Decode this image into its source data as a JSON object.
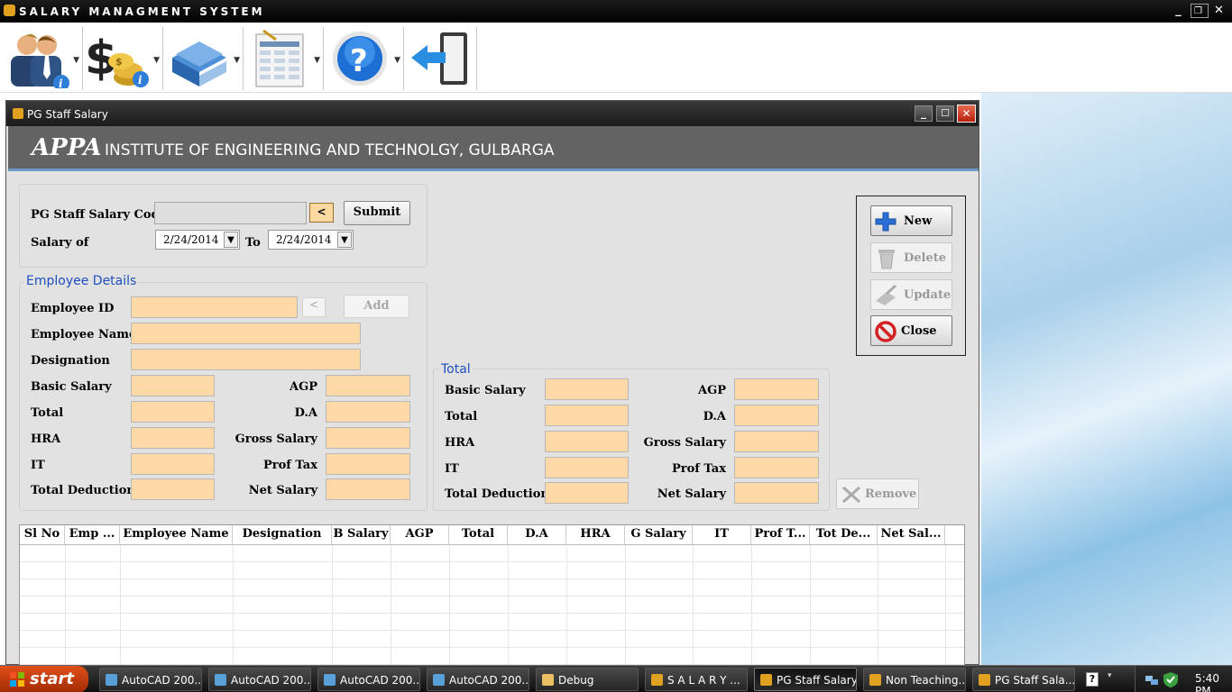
{
  "app": {
    "title": "SALARY MANAGMENT SYSTEM",
    "toolbar": [
      {
        "icon": "employee-info-icon"
      },
      {
        "icon": "salary-info-icon"
      },
      {
        "icon": "books-icon"
      },
      {
        "icon": "report-icon"
      },
      {
        "icon": "help-icon"
      },
      {
        "icon": "exit-icon"
      }
    ]
  },
  "window": {
    "title": "PG Staff Salary",
    "banner_logo": "APPA",
    "banner_name": "INSTITUTE OF ENGINEERING AND TECHNOLGY, GULBARGA"
  },
  "form": {
    "code_label": "PG Staff Salary Code",
    "code_value": "",
    "lookup_btn": "<",
    "submit_btn": "Submit",
    "salary_of_label": "Salary of",
    "date_from": "2/24/2014",
    "to_label": "To",
    "date_to": "2/24/2014"
  },
  "employee": {
    "legend": "Employee Details",
    "id_label": "Employee ID",
    "lookup_btn": "<",
    "add_btn": "Add",
    "name_label": "Employee Name",
    "designation_label": "Designation",
    "basic_salary": "Basic Salary",
    "agp": "AGP",
    "total": "Total",
    "da": "D.A",
    "hra": "HRA",
    "gross_salary": "Gross Salary",
    "it": "IT",
    "prof_tax": "Prof Tax",
    "total_deduction": "Total Deduction",
    "net_salary": "Net Salary"
  },
  "totals": {
    "legend": "Total",
    "basic_salary": "Basic Salary",
    "agp": "AGP",
    "total": "Total",
    "da": "D.A",
    "hra": "HRA",
    "gross_salary": "Gross Salary",
    "it": "IT",
    "prof_tax": "Prof Tax",
    "total_deduction": "Total Deduction",
    "net_salary": "Net Salary"
  },
  "actions": {
    "new": "New",
    "delete": "Delete",
    "update": "Update",
    "close": "Close",
    "remove": "Remove"
  },
  "grid": {
    "columns": [
      "Sl No",
      "Emp ...",
      "Employee Name",
      "Designation",
      "B Salary",
      "AGP",
      "Total",
      "D.A",
      "HRA",
      "G Salary",
      "IT",
      "Prof T...",
      "Tot De...",
      "Net Sal..."
    ],
    "rows": []
  },
  "taskbar": {
    "start": "start",
    "tasks": [
      "AutoCAD 200...",
      "AutoCAD 200...",
      "AutoCAD 200...",
      "AutoCAD 200...",
      "Debug",
      "S A L A R Y  ...",
      "PG Staff Salary",
      "Non Teaching...",
      "PG Staff Sala..."
    ],
    "time": "5:40 PM"
  },
  "colors": {
    "field_bg": "#fed9a8",
    "banner_bg": "#636363",
    "legend_text": "#1e4fbf",
    "close_icon": "#d42020",
    "new_icon": "#2a6fd6"
  }
}
